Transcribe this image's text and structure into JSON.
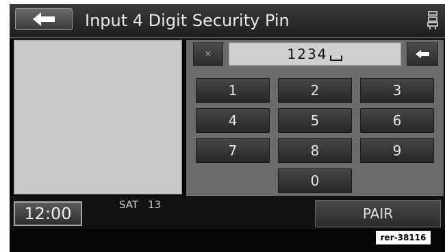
{
  "header": {
    "title": "Input 4 Digit Security Pin"
  },
  "pin": {
    "value": "1234"
  },
  "keypad": {
    "keys": [
      "1",
      "2",
      "3",
      "4",
      "5",
      "6",
      "7",
      "8",
      "9",
      "0"
    ]
  },
  "status": {
    "time": "12:00",
    "day": "SAT",
    "date": "13"
  },
  "actions": {
    "pair_label": "PAIR"
  },
  "reference": "rer-38116",
  "icons": {
    "back": "back-arrow-icon",
    "seat": "seat-icon",
    "clear": "clear-x-icon",
    "backspace": "backspace-arrow-icon"
  }
}
